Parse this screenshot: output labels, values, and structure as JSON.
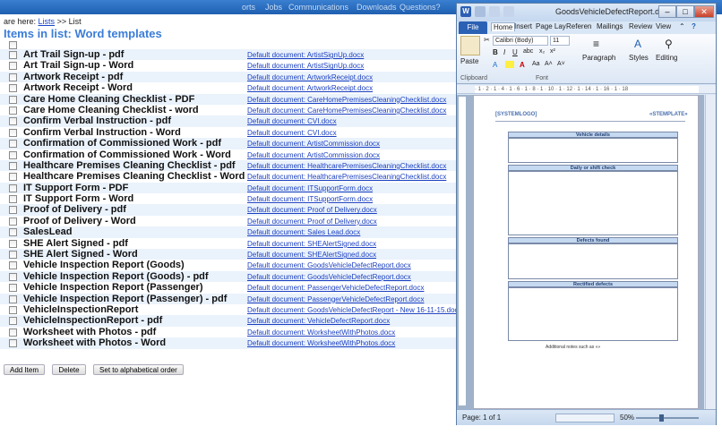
{
  "topnav": {
    "items": [
      "orts",
      "Jobs",
      "Communications",
      "Downloads",
      "Questions?"
    ]
  },
  "breadcrumb": {
    "prefix": "are here:",
    "link": "Lists",
    "sep": ">>",
    "current": "List"
  },
  "page_title": "Items in list: Word templates",
  "rows": [
    {
      "name": "Art Trail Sign-up - pdf",
      "doc": "Default document: ArtistSignUp.docx"
    },
    {
      "name": "Art Trail Sign-up - Word",
      "doc": "Default document: ArtistSignUp.docx"
    },
    {
      "name": "Artwork Receipt - pdf",
      "doc": "Default document: ArtworkReceipt.docx"
    },
    {
      "name": "Artwork Receipt - Word",
      "doc": "Default document: ArtworkReceipt.docx"
    },
    {
      "name": "Care Home Cleaning Checklist - PDF",
      "doc": "Default document: CareHomePremisesCleaningChecklist.docx"
    },
    {
      "name": "Care Home Cleaning Checklist - word",
      "doc": "Default document: CareHomePremisesCleaningChecklist.docx"
    },
    {
      "name": "Confirm Verbal Instruction - pdf",
      "doc": "Default document: CVI.docx"
    },
    {
      "name": "Confirm Verbal Instruction - Word",
      "doc": "Default document: CVI.docx"
    },
    {
      "name": "Confirmation of Commissioned Work - pdf",
      "doc": "Default document: ArtistCommission.docx"
    },
    {
      "name": "Confirmation of Commissioned Work - Word",
      "doc": "Default document: ArtistCommission.docx"
    },
    {
      "name": "Healthcare Premises Cleaning Checklist - pdf",
      "doc": "Default document: HealthcarePremisesCleaningChecklist.docx"
    },
    {
      "name": "Healthcare Premises Cleaning Checklist - Word",
      "doc": "Default document: HealthcarePremisesCleaningChecklist.docx"
    },
    {
      "name": "IT Support Form - PDF",
      "doc": "Default document: ITSupportForm.docx"
    },
    {
      "name": "IT Support Form - Word",
      "doc": "Default document: ITSupportForm.docx"
    },
    {
      "name": "Proof of Delivery - pdf",
      "doc": "Default document: Proof of Delivery.docx"
    },
    {
      "name": "Proof of Delivery - Word",
      "doc": "Default document: Proof of Delivery.docx"
    },
    {
      "name": "SalesLead",
      "doc": "Default document: Sales Lead.docx"
    },
    {
      "name": "SHE Alert Signed - pdf",
      "doc": "Default document: SHEAlertSigned.docx"
    },
    {
      "name": "SHE Alert Signed - Word",
      "doc": "Default document: SHEAlertSigned.docx"
    },
    {
      "name": "Vehicle Inspection Report (Goods)",
      "doc": "Default document: GoodsVehicleDefectReport.docx"
    },
    {
      "name": "Vehicle Inspection Report (Goods) - pdf",
      "doc": "Default document: GoodsVehicleDefectReport.docx"
    },
    {
      "name": "Vehicle Inspection Report (Passenger)",
      "doc": "Default document: PassengerVehicleDefectReport.docx"
    },
    {
      "name": "Vehicle Inspection Report (Passenger) - pdf",
      "doc": "Default document: PassengerVehicleDefectReport.docx"
    },
    {
      "name": "VehicleInspectionReport",
      "doc": "Default document: GoodsVehicleDefectReport - New 16-11-15.docx"
    },
    {
      "name": "VehicleInspectionReport - pdf",
      "doc": "Default document: VehicleDefectReport.docx"
    },
    {
      "name": "Worksheet with Photos - pdf",
      "doc": "Default document: WorksheetWithPhotos.docx"
    },
    {
      "name": "Worksheet with Photos - Word",
      "doc": "Default document: WorksheetWithPhotos.docx"
    }
  ],
  "buttons": {
    "add": "Add Item",
    "delete": "Delete",
    "alpha": "Set to alphabetical order"
  },
  "word": {
    "title": "GoodsVehicleDefectReport.d...",
    "tabs": [
      "File",
      "Home",
      "Insert",
      "Page Lay",
      "Referen",
      "Mailings",
      "Review",
      "View"
    ],
    "font_name": "Calibri (Body)",
    "font_size": "11",
    "paste": "Paste",
    "paragraph": "Paragraph",
    "styles": "Styles",
    "editing": "Editing",
    "clipboard": "Clipboard",
    "font_group": "Font",
    "status_page": "Page: 1 of 1",
    "zoom": "50%",
    "doc": {
      "system_logo": "[SYSTEMLOGO]",
      "stemplate": "«STEMPLATE»",
      "vehicle_details": "Vehicle details",
      "daily_check": "Daily or shift check",
      "defects_found": "Defects found",
      "rectified": "Rectified defects",
      "footer_note": "Additional notes such as «»"
    }
  },
  "colors": {
    "accent": "#3b7dd8",
    "link": "#1a3fc0",
    "row_alt": "#eaf2fc",
    "nav": "#2a6fc0"
  }
}
